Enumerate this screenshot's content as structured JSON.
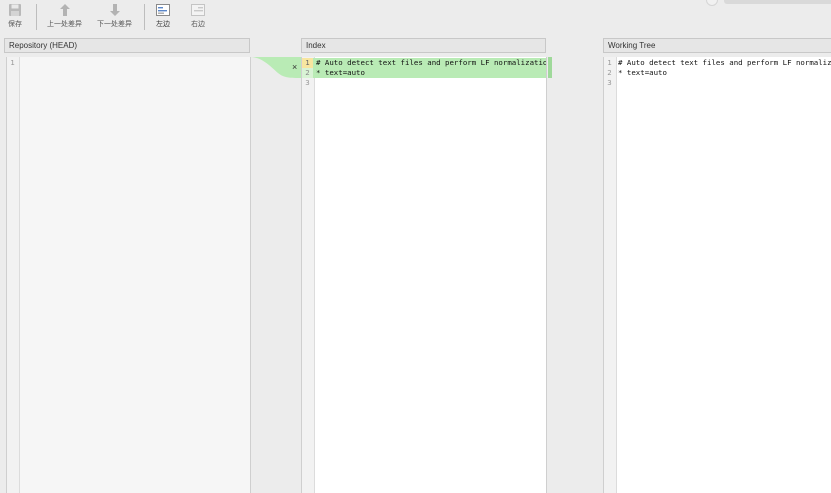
{
  "toolbar": {
    "save": {
      "label": "保存",
      "icon": "save-icon"
    },
    "prev_diff": {
      "label": "上一处差异",
      "icon": "arrow-up-icon"
    },
    "next_diff": {
      "label": "下一处差异",
      "icon": "arrow-down-icon"
    },
    "left": {
      "label": "左边",
      "icon": "left-side-icon"
    },
    "right": {
      "label": "右边",
      "icon": "right-side-icon"
    }
  },
  "panes": {
    "repository": {
      "title": "Repository (HEAD)",
      "lines": [
        {
          "num": "1",
          "text": ""
        }
      ]
    },
    "index": {
      "title": "Index",
      "lines": [
        {
          "num": "1",
          "text": "# Auto detect text files and perform LF normalization"
        },
        {
          "num": "2",
          "text": "* text=auto"
        },
        {
          "num": "3",
          "text": ""
        }
      ]
    },
    "working_tree": {
      "title": "Working Tree",
      "lines": [
        {
          "num": "1",
          "text": "# Auto detect text files and perform LF normalization"
        },
        {
          "num": "2",
          "text": "* text=auto"
        },
        {
          "num": "3",
          "text": ""
        }
      ]
    }
  },
  "diff_action": {
    "discard_symbol": "×"
  },
  "colors": {
    "added_line": "#b9ebb5",
    "connector": "#b9ebb5",
    "current_line_marker": "#f8e6a0"
  }
}
